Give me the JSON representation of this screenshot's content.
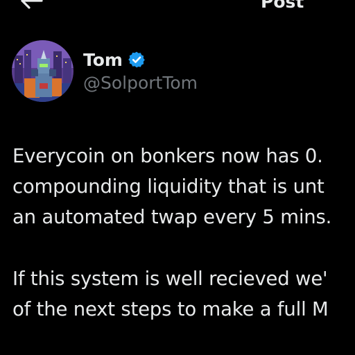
{
  "header": {
    "back_icon": "arrow-left-icon",
    "title": "Post"
  },
  "author": {
    "display_name": "Tom",
    "verified_icon": "verified-badge-icon",
    "verified_color": "#1d9bf0",
    "handle": "@SolportTom"
  },
  "post": {
    "paragraphs": [
      {
        "lines": [
          "Everycoin on bonkers now has 0.",
          "compounding liquidity that is unt",
          "an automated twap every 5 mins."
        ]
      },
      {
        "lines": [
          "If this system is well recieved we'",
          "of the next steps to make a full M"
        ]
      }
    ]
  },
  "colors": {
    "background": "#000000",
    "primary_text": "#e7e9ea",
    "secondary_text": "#71767b",
    "accent": "#1d9bf0"
  }
}
